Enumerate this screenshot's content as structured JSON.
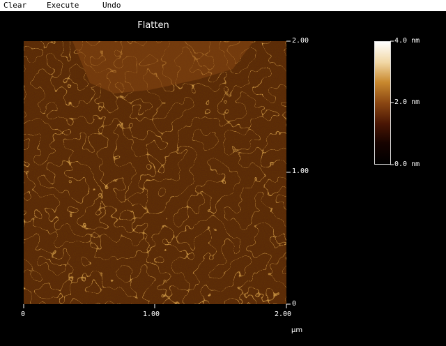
{
  "menu": {
    "clear": "Clear",
    "execute": "Execute",
    "undo": "Undo"
  },
  "title": "Flatten",
  "y_axis": {
    "top": "2.00",
    "mid": "1.00",
    "bottom": "0"
  },
  "x_axis": {
    "left": "0",
    "mid": "1.00",
    "right": "2.00",
    "unit": "µm"
  },
  "colorbar": {
    "max": "4.0 nm",
    "mid": "2.0 nm",
    "min": "0.0 nm",
    "colors": [
      "#ffffff",
      "#f1d7a4",
      "#c9892f",
      "#8b4712",
      "#4a1604",
      "#170300",
      "#000000"
    ]
  },
  "image": {
    "background_color": "#5a2a08",
    "fiber_color": "#d9a24a",
    "highlight_color": "#fff1c2"
  }
}
